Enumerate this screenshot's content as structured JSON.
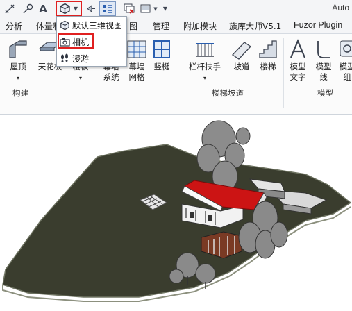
{
  "app": {
    "title_fragment": "Auto"
  },
  "qat": {
    "icons": [
      "measure-icon",
      "tag-icon",
      "text-icon",
      "3d-view-icon",
      "dropdown-arrow-icon",
      "section-icon",
      "switch-windows-icon",
      "close-hidden-icon",
      "sheet-icon",
      "customize-arrow-icon"
    ],
    "text_glyph": "A"
  },
  "tabs": [
    "分析",
    "体量和",
    "图",
    "管理",
    "附加模块",
    "族库大师V5.1",
    "Fuzor Plugin"
  ],
  "ribbon": {
    "build_buttons": [
      {
        "label": "屋顶",
        "has_arrow": true
      },
      {
        "label": "天花板",
        "has_arrow": false
      },
      {
        "label": "楼板",
        "has_arrow": true
      },
      {
        "label": "幕墙\n系统",
        "has_arrow": false
      },
      {
        "label": "幕墙\n网格",
        "has_arrow": false
      },
      {
        "label": "竖梃",
        "has_arrow": false
      }
    ],
    "circulation_buttons": [
      {
        "label": "栏杆扶手",
        "has_arrow": true
      },
      {
        "label": "坡道",
        "has_arrow": false
      },
      {
        "label": "楼梯",
        "has_arrow": false
      }
    ],
    "model_buttons": [
      {
        "label": "模型\n文字",
        "has_arrow": false
      },
      {
        "label": "模型\n线",
        "has_arrow": false
      },
      {
        "label": "模型\n组",
        "has_arrow": false
      }
    ],
    "groups": {
      "build": "构建",
      "circulation": "楼梯坡道",
      "model": "模型"
    }
  },
  "dropdown_menu": {
    "items": [
      {
        "label": "默认三维视图",
        "icon": "3d-view-icon",
        "highlighted": false
      },
      {
        "label": "相机",
        "icon": "camera-icon",
        "highlighted": true
      },
      {
        "label": "漫游",
        "icon": "walkthrough-footprints-icon",
        "highlighted": false
      }
    ]
  },
  "colors": {
    "highlight_box": "#e02020",
    "roof": "#cc1414",
    "terrain": "#3a3d2e"
  }
}
